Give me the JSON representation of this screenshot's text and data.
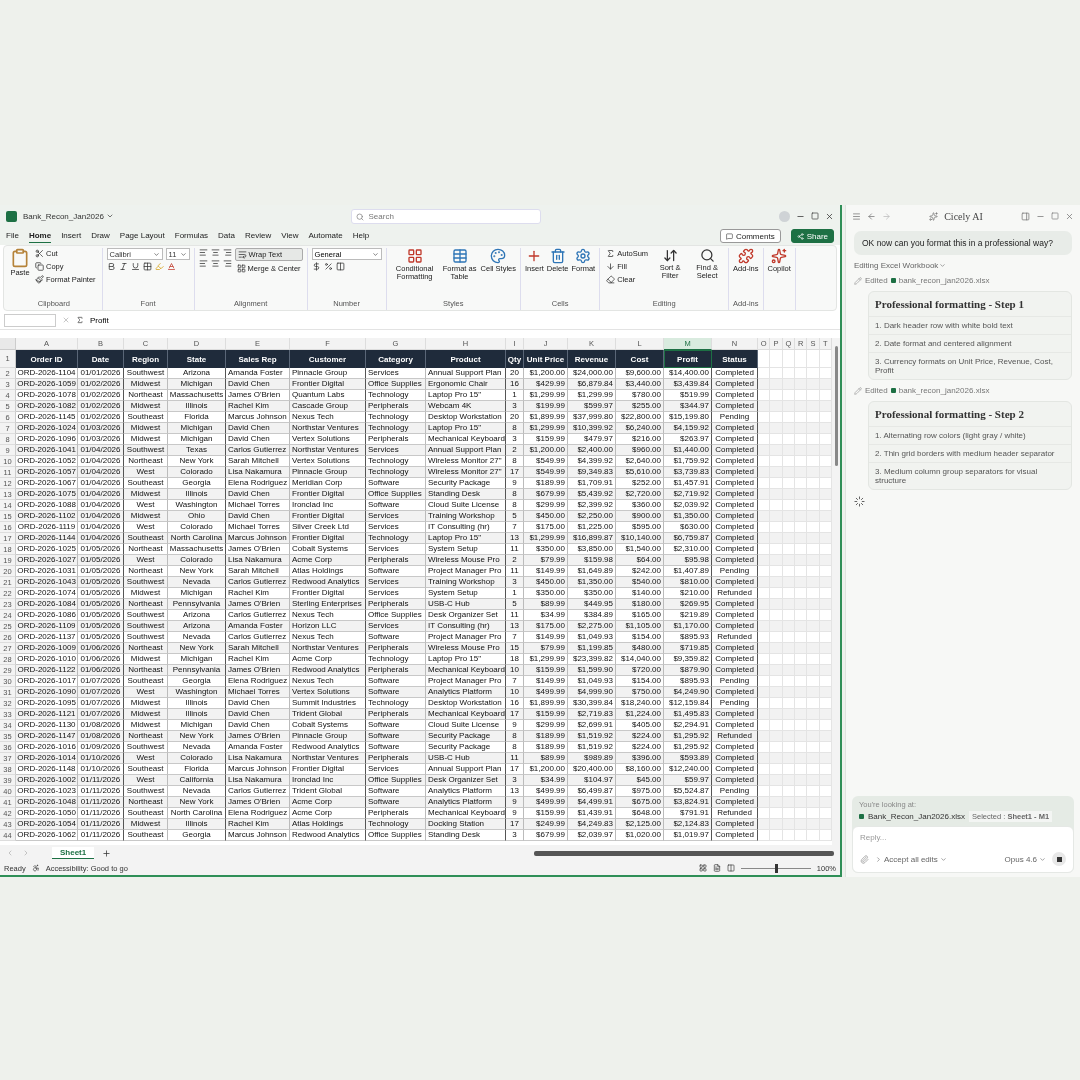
{
  "excel": {
    "title": "Bank_Recon_Jan2026",
    "search": {
      "placeholder": "Search"
    },
    "menu_tabs": [
      {
        "label": "File",
        "selected": false
      },
      {
        "label": "Home",
        "selected": true
      },
      {
        "label": "Insert",
        "selected": false
      },
      {
        "label": "Draw",
        "selected": false
      },
      {
        "label": "Page Layout",
        "selected": false
      },
      {
        "label": "Formulas",
        "selected": false
      },
      {
        "label": "Data",
        "selected": false
      },
      {
        "label": "Review",
        "selected": false
      },
      {
        "label": "View",
        "selected": false
      },
      {
        "label": "Automate",
        "selected": false
      },
      {
        "label": "Help",
        "selected": false
      }
    ],
    "comments": "Comments",
    "share": "Share",
    "ribbon": [
      {
        "kind": "clipboard",
        "label": "Clipboard",
        "large": [
          "Paste"
        ],
        "small": [
          "Cut",
          "Copy",
          "Format Painter"
        ]
      },
      {
        "kind": "font",
        "label": "Font",
        "font": "Calibri",
        "size": "11"
      },
      {
        "kind": "alignment",
        "label": "Alignment",
        "small": [
          "Wrap Text",
          "Merge & Center"
        ]
      },
      {
        "kind": "number",
        "label": "Number",
        "format": "General"
      },
      {
        "kind": "large",
        "label": "Styles",
        "large": [
          "Conditional Formatting",
          "Format as Table",
          "Cell Styles"
        ]
      },
      {
        "kind": "large",
        "label": "Cells",
        "large": [
          "Insert",
          "Delete",
          "Format"
        ]
      },
      {
        "kind": "editing",
        "label": "Editing",
        "small": [
          "AutoSum",
          "Fill",
          "Clear"
        ],
        "large": [
          "Sort & Filter",
          "Find & Select"
        ]
      },
      {
        "kind": "large",
        "label": "Add-ins",
        "large": [
          "Add-ins"
        ]
      },
      {
        "kind": "large",
        "large": [
          "Copilot"
        ]
      }
    ],
    "formula": "Profit",
    "column_letters": [
      {
        "label": "A",
        "selected": false
      },
      {
        "label": "B",
        "selected": false
      },
      {
        "label": "C",
        "selected": false
      },
      {
        "label": "D",
        "selected": false
      },
      {
        "label": "E",
        "selected": false
      },
      {
        "label": "F",
        "selected": false
      },
      {
        "label": "G",
        "selected": false
      },
      {
        "label": "H",
        "selected": false
      },
      {
        "label": "I",
        "selected": false
      },
      {
        "label": "J",
        "selected": false
      },
      {
        "label": "K",
        "selected": false
      },
      {
        "label": "L",
        "selected": false
      },
      {
        "label": "M",
        "selected": true
      },
      {
        "label": "N",
        "selected": false
      },
      {
        "label": "O",
        "selected": false
      },
      {
        "label": "P",
        "selected": false
      },
      {
        "label": "Q",
        "selected": false
      },
      {
        "label": "R",
        "selected": false
      },
      {
        "label": "S",
        "selected": false
      },
      {
        "label": "T",
        "selected": false
      }
    ],
    "header": {
      "number": "1",
      "cells": [
        "Order ID",
        "Date",
        "Region",
        "State",
        "Sales Rep",
        "Customer",
        "Category",
        "Product",
        "Qty",
        "Unit Price",
        "Revenue",
        "Cost",
        "Profit",
        "Status"
      ]
    },
    "rows": [
      {
        "number": "2",
        "cells": [
          "ORD-2026-1104",
          "01/01/2026",
          "Southwest",
          "Arizona",
          "Amanda Foster",
          "Pinnacle Group",
          "Services",
          "Annual Support Plan",
          "20",
          "$1,200.00",
          "$24,000.00",
          "$9,600.00",
          "$14,400.00",
          "Completed"
        ]
      },
      {
        "number": "3",
        "cells": [
          "ORD-2026-1059",
          "01/02/2026",
          "Midwest",
          "Michigan",
          "David Chen",
          "Frontier Digital",
          "Office Supplies",
          "Ergonomic Chair",
          "16",
          "$429.99",
          "$6,879.84",
          "$3,440.00",
          "$3,439.84",
          "Completed"
        ]
      },
      {
        "number": "4",
        "cells": [
          "ORD-2026-1078",
          "01/02/2026",
          "Northeast",
          "Massachusetts",
          "James O'Brien",
          "Quantum Labs",
          "Technology",
          "Laptop Pro 15\"",
          "1",
          "$1,299.99",
          "$1,299.99",
          "$780.00",
          "$519.99",
          "Completed"
        ]
      },
      {
        "number": "5",
        "cells": [
          "ORD-2026-1082",
          "01/02/2026",
          "Midwest",
          "Illinois",
          "Rachel Kim",
          "Cascade Group",
          "Peripherals",
          "Webcam 4K",
          "3",
          "$199.99",
          "$599.97",
          "$255.00",
          "$344.97",
          "Completed"
        ]
      },
      {
        "number": "6",
        "cells": [
          "ORD-2026-1145",
          "01/02/2026",
          "Southeast",
          "Florida",
          "Marcus Johnson",
          "Nexus Tech",
          "Technology",
          "Desktop Workstation",
          "20",
          "$1,899.99",
          "$37,999.80",
          "$22,800.00",
          "$15,199.80",
          "Pending"
        ]
      },
      {
        "number": "7",
        "cells": [
          "ORD-2026-1024",
          "01/03/2026",
          "Midwest",
          "Michigan",
          "David Chen",
          "Northstar Ventures",
          "Technology",
          "Laptop Pro 15\"",
          "8",
          "$1,299.99",
          "$10,399.92",
          "$6,240.00",
          "$4,159.92",
          "Completed"
        ]
      },
      {
        "number": "8",
        "cells": [
          "ORD-2026-1096",
          "01/03/2026",
          "Midwest",
          "Michigan",
          "David Chen",
          "Vertex Solutions",
          "Peripherals",
          "Mechanical Keyboard",
          "3",
          "$159.99",
          "$479.97",
          "$216.00",
          "$263.97",
          "Completed"
        ]
      },
      {
        "number": "9",
        "cells": [
          "ORD-2026-1041",
          "01/04/2026",
          "Southwest",
          "Texas",
          "Carlos Gutierrez",
          "Northstar Ventures",
          "Services",
          "Annual Support Plan",
          "2",
          "$1,200.00",
          "$2,400.00",
          "$960.00",
          "$1,440.00",
          "Completed"
        ]
      },
      {
        "number": "10",
        "cells": [
          "ORD-2026-1052",
          "01/04/2026",
          "Northeast",
          "New York",
          "Sarah Mitchell",
          "Vertex Solutions",
          "Technology",
          "Wireless Monitor 27\"",
          "8",
          "$549.99",
          "$4,399.92",
          "$2,640.00",
          "$1,759.92",
          "Completed"
        ]
      },
      {
        "number": "11",
        "cells": [
          "ORD-2026-1057",
          "01/04/2026",
          "West",
          "Colorado",
          "Lisa Nakamura",
          "Pinnacle Group",
          "Technology",
          "Wireless Monitor 27\"",
          "17",
          "$549.99",
          "$9,349.83",
          "$5,610.00",
          "$3,739.83",
          "Completed"
        ]
      },
      {
        "number": "12",
        "cells": [
          "ORD-2026-1067",
          "01/04/2026",
          "Southeast",
          "Georgia",
          "Elena Rodriguez",
          "Meridian Corp",
          "Software",
          "Security Package",
          "9",
          "$189.99",
          "$1,709.91",
          "$252.00",
          "$1,457.91",
          "Completed"
        ]
      },
      {
        "number": "13",
        "cells": [
          "ORD-2026-1075",
          "01/04/2026",
          "Midwest",
          "Illinois",
          "David Chen",
          "Frontier Digital",
          "Office Supplies",
          "Standing Desk",
          "8",
          "$679.99",
          "$5,439.92",
          "$2,720.00",
          "$2,719.92",
          "Completed"
        ]
      },
      {
        "number": "14",
        "cells": [
          "ORD-2026-1088",
          "01/04/2026",
          "West",
          "Washington",
          "Michael Torres",
          "Ironclad Inc",
          "Software",
          "Cloud Suite License",
          "8",
          "$299.99",
          "$2,399.92",
          "$360.00",
          "$2,039.92",
          "Completed"
        ]
      },
      {
        "number": "15",
        "cells": [
          "ORD-2026-1102",
          "01/04/2026",
          "Midwest",
          "Ohio",
          "David Chen",
          "Frontier Digital",
          "Services",
          "Training Workshop",
          "5",
          "$450.00",
          "$2,250.00",
          "$900.00",
          "$1,350.00",
          "Completed"
        ]
      },
      {
        "number": "16",
        "cells": [
          "ORD-2026-1119",
          "01/04/2026",
          "West",
          "Colorado",
          "Michael Torres",
          "Silver Creek Ltd",
          "Services",
          "IT Consulting (hr)",
          "7",
          "$175.00",
          "$1,225.00",
          "$595.00",
          "$630.00",
          "Completed"
        ]
      },
      {
        "number": "17",
        "cells": [
          "ORD-2026-1144",
          "01/04/2026",
          "Southeast",
          "North Carolina",
          "Marcus Johnson",
          "Frontier Digital",
          "Technology",
          "Laptop Pro 15\"",
          "13",
          "$1,299.99",
          "$16,899.87",
          "$10,140.00",
          "$6,759.87",
          "Completed"
        ]
      },
      {
        "number": "18",
        "cells": [
          "ORD-2026-1025",
          "01/05/2026",
          "Northeast",
          "Massachusetts",
          "James O'Brien",
          "Cobalt Systems",
          "Services",
          "System Setup",
          "11",
          "$350.00",
          "$3,850.00",
          "$1,540.00",
          "$2,310.00",
          "Completed"
        ]
      },
      {
        "number": "19",
        "cells": [
          "ORD-2026-1027",
          "01/05/2026",
          "West",
          "Colorado",
          "Lisa Nakamura",
          "Acme Corp",
          "Peripherals",
          "Wireless Mouse Pro",
          "2",
          "$79.99",
          "$159.98",
          "$64.00",
          "$95.98",
          "Completed"
        ]
      },
      {
        "number": "20",
        "cells": [
          "ORD-2026-1031",
          "01/05/2026",
          "Northeast",
          "New York",
          "Sarah Mitchell",
          "Atlas Holdings",
          "Software",
          "Project Manager Pro",
          "11",
          "$149.99",
          "$1,649.89",
          "$242.00",
          "$1,407.89",
          "Pending"
        ]
      },
      {
        "number": "21",
        "cells": [
          "ORD-2026-1043",
          "01/05/2026",
          "Southwest",
          "Nevada",
          "Carlos Gutierrez",
          "Redwood Analytics",
          "Services",
          "Training Workshop",
          "3",
          "$450.00",
          "$1,350.00",
          "$540.00",
          "$810.00",
          "Completed"
        ]
      },
      {
        "number": "22",
        "cells": [
          "ORD-2026-1074",
          "01/05/2026",
          "Midwest",
          "Michigan",
          "Rachel Kim",
          "Frontier Digital",
          "Services",
          "System Setup",
          "1",
          "$350.00",
          "$350.00",
          "$140.00",
          "$210.00",
          "Refunded"
        ]
      },
      {
        "number": "23",
        "cells": [
          "ORD-2026-1084",
          "01/05/2026",
          "Northeast",
          "Pennsylvania",
          "James O'Brien",
          "Sterling Enterprises",
          "Peripherals",
          "USB-C Hub",
          "5",
          "$89.99",
          "$449.95",
          "$180.00",
          "$269.95",
          "Completed"
        ]
      },
      {
        "number": "24",
        "cells": [
          "ORD-2026-1086",
          "01/05/2026",
          "Southwest",
          "Arizona",
          "Carlos Gutierrez",
          "Nexus Tech",
          "Office Supplies",
          "Desk Organizer Set",
          "11",
          "$34.99",
          "$384.89",
          "$165.00",
          "$219.89",
          "Completed"
        ]
      },
      {
        "number": "25",
        "cells": [
          "ORD-2026-1109",
          "01/05/2026",
          "Southwest",
          "Arizona",
          "Amanda Foster",
          "Horizon LLC",
          "Services",
          "IT Consulting (hr)",
          "13",
          "$175.00",
          "$2,275.00",
          "$1,105.00",
          "$1,170.00",
          "Completed"
        ]
      },
      {
        "number": "26",
        "cells": [
          "ORD-2026-1137",
          "01/05/2026",
          "Southwest",
          "Nevada",
          "Carlos Gutierrez",
          "Nexus Tech",
          "Software",
          "Project Manager Pro",
          "7",
          "$149.99",
          "$1,049.93",
          "$154.00",
          "$895.93",
          "Refunded"
        ]
      },
      {
        "number": "27",
        "cells": [
          "ORD-2026-1009",
          "01/06/2026",
          "Northeast",
          "New York",
          "Sarah Mitchell",
          "Northstar Ventures",
          "Peripherals",
          "Wireless Mouse Pro",
          "15",
          "$79.99",
          "$1,199.85",
          "$480.00",
          "$719.85",
          "Completed"
        ]
      },
      {
        "number": "28",
        "cells": [
          "ORD-2026-1010",
          "01/06/2026",
          "Midwest",
          "Michigan",
          "Rachel Kim",
          "Acme Corp",
          "Technology",
          "Laptop Pro 15\"",
          "18",
          "$1,299.99",
          "$23,399.82",
          "$14,040.00",
          "$9,359.82",
          "Completed"
        ]
      },
      {
        "number": "29",
        "cells": [
          "ORD-2026-1122",
          "01/06/2026",
          "Northeast",
          "Pennsylvania",
          "James O'Brien",
          "Redwood Analytics",
          "Peripherals",
          "Mechanical Keyboard",
          "10",
          "$159.99",
          "$1,599.90",
          "$720.00",
          "$879.90",
          "Completed"
        ]
      },
      {
        "number": "30",
        "cells": [
          "ORD-2026-1017",
          "01/07/2026",
          "Southeast",
          "Georgia",
          "Elena Rodriguez",
          "Nexus Tech",
          "Software",
          "Project Manager Pro",
          "7",
          "$149.99",
          "$1,049.93",
          "$154.00",
          "$895.93",
          "Pending"
        ]
      },
      {
        "number": "31",
        "cells": [
          "ORD-2026-1090",
          "01/07/2026",
          "West",
          "Washington",
          "Michael Torres",
          "Vertex Solutions",
          "Software",
          "Analytics Platform",
          "10",
          "$499.99",
          "$4,999.90",
          "$750.00",
          "$4,249.90",
          "Completed"
        ]
      },
      {
        "number": "32",
        "cells": [
          "ORD-2026-1095",
          "01/07/2026",
          "Midwest",
          "Illinois",
          "David Chen",
          "Summit Industries",
          "Technology",
          "Desktop Workstation",
          "16",
          "$1,899.99",
          "$30,399.84",
          "$18,240.00",
          "$12,159.84",
          "Pending"
        ]
      },
      {
        "number": "33",
        "cells": [
          "ORD-2026-1121",
          "01/07/2026",
          "Midwest",
          "Illinois",
          "David Chen",
          "Trident Global",
          "Peripherals",
          "Mechanical Keyboard",
          "17",
          "$159.99",
          "$2,719.83",
          "$1,224.00",
          "$1,495.83",
          "Completed"
        ]
      },
      {
        "number": "34",
        "cells": [
          "ORD-2026-1130",
          "01/08/2026",
          "Midwest",
          "Michigan",
          "David Chen",
          "Cobalt Systems",
          "Software",
          "Cloud Suite License",
          "9",
          "$299.99",
          "$2,699.91",
          "$405.00",
          "$2,294.91",
          "Completed"
        ]
      },
      {
        "number": "35",
        "cells": [
          "ORD-2026-1147",
          "01/08/2026",
          "Northeast",
          "New York",
          "James O'Brien",
          "Pinnacle Group",
          "Software",
          "Security Package",
          "8",
          "$189.99",
          "$1,519.92",
          "$224.00",
          "$1,295.92",
          "Refunded"
        ]
      },
      {
        "number": "36",
        "cells": [
          "ORD-2026-1016",
          "01/09/2026",
          "Southwest",
          "Nevada",
          "Amanda Foster",
          "Redwood Analytics",
          "Software",
          "Security Package",
          "8",
          "$189.99",
          "$1,519.92",
          "$224.00",
          "$1,295.92",
          "Completed"
        ]
      },
      {
        "number": "37",
        "cells": [
          "ORD-2026-1014",
          "01/10/2026",
          "West",
          "Colorado",
          "Lisa Nakamura",
          "Northstar Ventures",
          "Peripherals",
          "USB-C Hub",
          "11",
          "$89.99",
          "$989.89",
          "$396.00",
          "$593.89",
          "Completed"
        ]
      },
      {
        "number": "38",
        "cells": [
          "ORD-2026-1148",
          "01/10/2026",
          "Southeast",
          "Florida",
          "Marcus Johnson",
          "Frontier Digital",
          "Services",
          "Annual Support Plan",
          "17",
          "$1,200.00",
          "$20,400.00",
          "$8,160.00",
          "$12,240.00",
          "Completed"
        ]
      },
      {
        "number": "39",
        "cells": [
          "ORD-2026-1002",
          "01/11/2026",
          "West",
          "California",
          "Lisa Nakamura",
          "Ironclad Inc",
          "Office Supplies",
          "Desk Organizer Set",
          "3",
          "$34.99",
          "$104.97",
          "$45.00",
          "$59.97",
          "Completed"
        ]
      },
      {
        "number": "40",
        "cells": [
          "ORD-2026-1023",
          "01/11/2026",
          "Southwest",
          "Nevada",
          "Carlos Gutierrez",
          "Trident Global",
          "Software",
          "Analytics Platform",
          "13",
          "$499.99",
          "$6,499.87",
          "$975.00",
          "$5,524.87",
          "Pending"
        ]
      },
      {
        "number": "41",
        "cells": [
          "ORD-2026-1048",
          "01/11/2026",
          "Northeast",
          "New York",
          "James O'Brien",
          "Acme Corp",
          "Software",
          "Analytics Platform",
          "9",
          "$499.99",
          "$4,499.91",
          "$675.00",
          "$3,824.91",
          "Completed"
        ]
      },
      {
        "number": "42",
        "cells": [
          "ORD-2026-1050",
          "01/11/2026",
          "Southeast",
          "North Carolina",
          "Elena Rodriguez",
          "Acme Corp",
          "Peripherals",
          "Mechanical Keyboard",
          "9",
          "$159.99",
          "$1,439.91",
          "$648.00",
          "$791.91",
          "Refunded"
        ]
      },
      {
        "number": "43",
        "cells": [
          "ORD-2026-1054",
          "01/11/2026",
          "Midwest",
          "Illinois",
          "Rachel Kim",
          "Atlas Holdings",
          "Technology",
          "Docking Station",
          "17",
          "$249.99",
          "$4,249.83",
          "$2,125.00",
          "$2,124.83",
          "Completed"
        ]
      },
      {
        "number": "44",
        "cells": [
          "ORD-2026-1062",
          "01/11/2026",
          "Southeast",
          "Georgia",
          "Marcus Johnson",
          "Redwood Analytics",
          "Office Supplies",
          "Standing Desk",
          "3",
          "$679.99",
          "$2,039.97",
          "$1,020.00",
          "$1,019.97",
          "Completed"
        ]
      }
    ],
    "sheet_tabs": [
      {
        "label": "Sheet1",
        "selected": true
      }
    ],
    "status": "Ready",
    "accessibility": "Accessibility: Good to go",
    "zoom_slider": {
      "level": 0.5
    },
    "zoom": "100%"
  },
  "chat": {
    "title": "Cicely AI",
    "user_message": "OK now can you format this in a professional way?",
    "mode": "Editing Excel Workbook",
    "steps": [
      {
        "action": "Edited",
        "file": "bank_recon_jan2026.xlsx",
        "title": "Professional formatting - Step 1",
        "items": [
          "1. Dark header row with white bold text",
          "2. Date format and centered alignment",
          "3. Currency formats on Unit Price, Revenue, Cost, Profit"
        ]
      },
      {
        "action": "Edited",
        "file": "bank_recon_jan2026.xlsx",
        "title": "Professional formatting - Step 2",
        "items": [
          "1. Alternating row colors (light gray / white)",
          "2. Thin grid borders with medium header separator",
          "3. Medium column group separators for visual structure"
        ]
      }
    ],
    "context_label": "You're looking at:",
    "context_file": "Bank_Recon_Jan2026.xlsx",
    "selection": "Selected : **Sheet1 - M1**",
    "reply": {
      "placeholder": "Reply..."
    },
    "accept": "Accept all edits",
    "model": "Opus 4.6"
  }
}
